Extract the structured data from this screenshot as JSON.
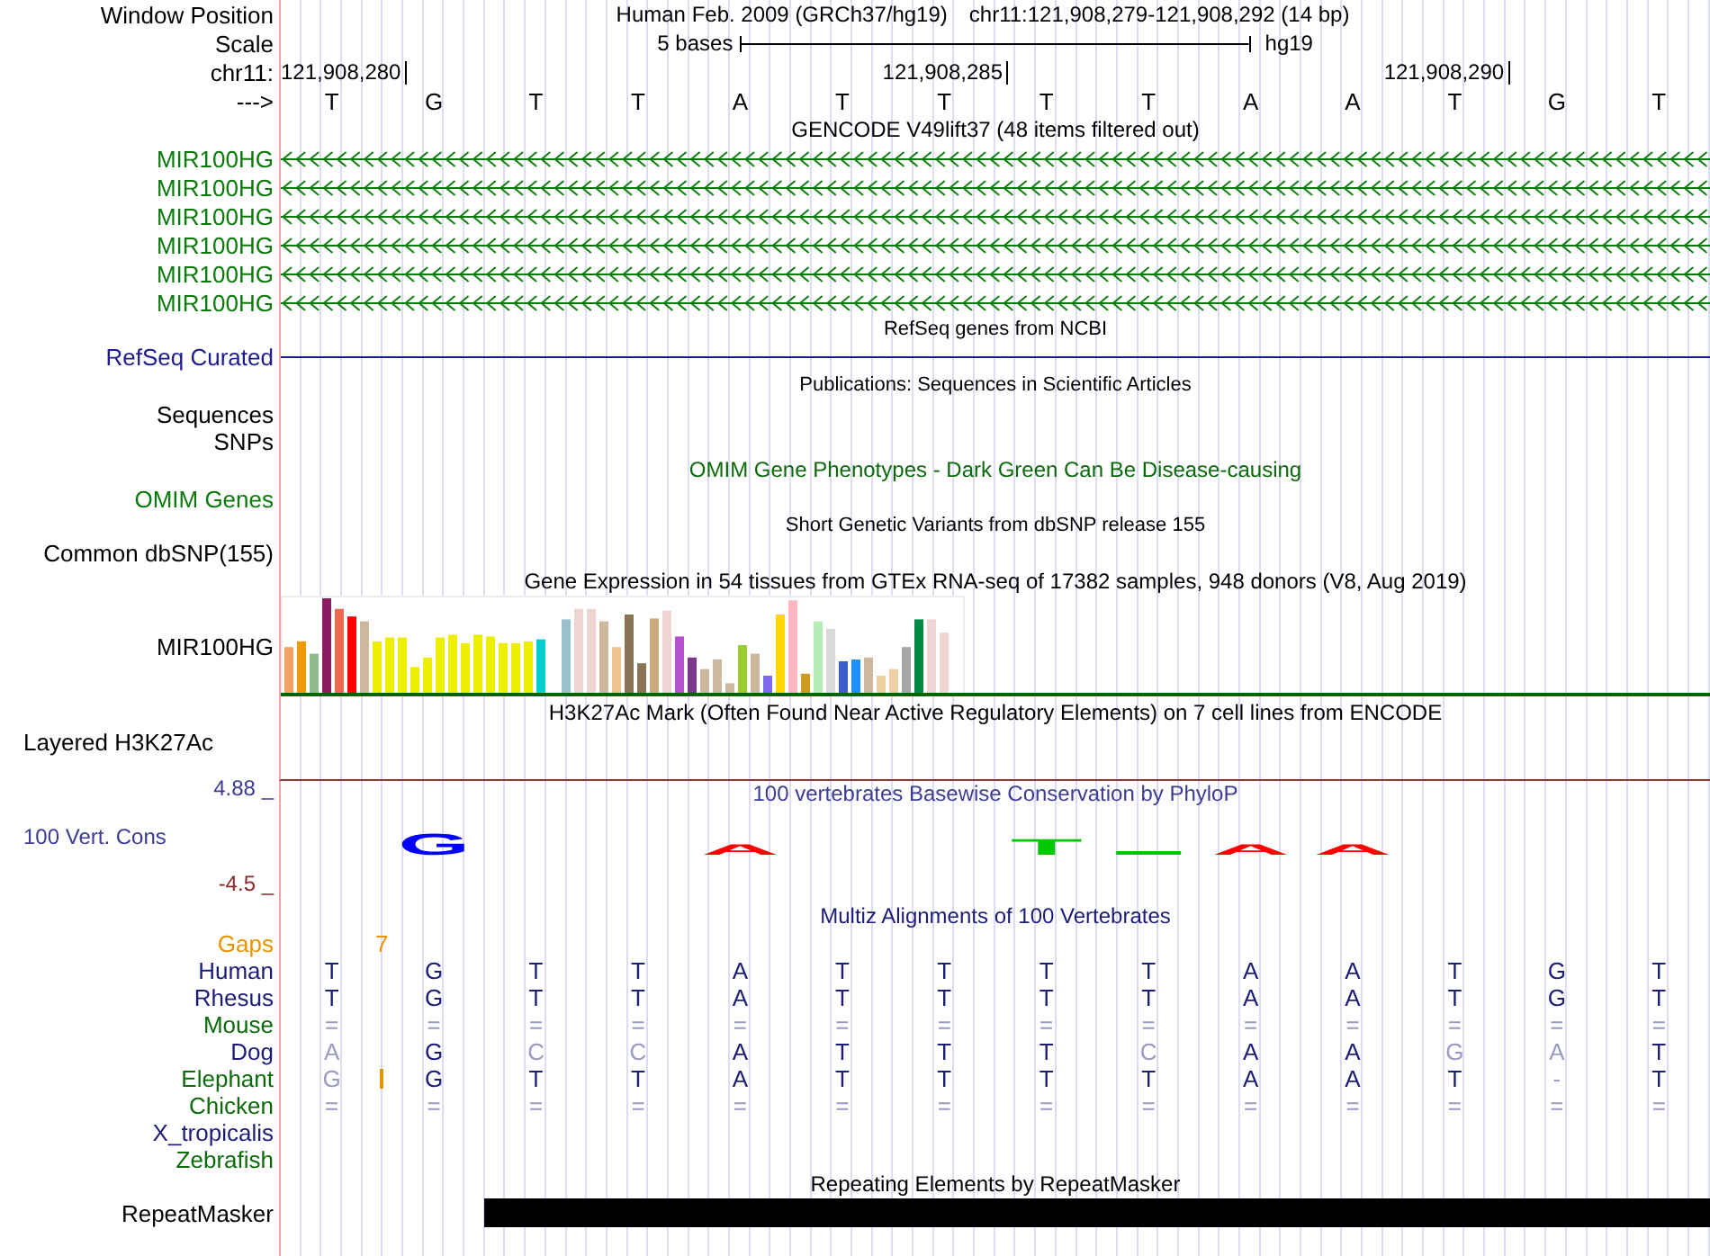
{
  "ruler": {
    "position_label": "Window Position",
    "assembly": "Human Feb. 2009 (GRCh37/hg19)",
    "position": "chr11:121,908,279-121,908,292 (14 bp)",
    "scale_label": "Scale",
    "scale_text": "5 bases",
    "scale_db": "hg19",
    "chrom_label": "chr11:",
    "ticks": [
      "121,908,280",
      "121,908,285",
      "121,908,290"
    ],
    "strand_label": "--->",
    "bases": [
      "T",
      "G",
      "T",
      "T",
      "A",
      "T",
      "T",
      "T",
      "T",
      "A",
      "A",
      "T",
      "G",
      "T"
    ]
  },
  "gencode": {
    "title": "GENCODE V49lift37 (48 items filtered out)",
    "items": [
      "MIR100HG",
      "MIR100HG",
      "MIR100HG",
      "MIR100HG",
      "MIR100HG",
      "MIR100HG"
    ]
  },
  "refseq": {
    "title": "RefSeq genes from NCBI",
    "label": "RefSeq Curated"
  },
  "publications": {
    "title": "Publications: Sequences in Scientific Articles",
    "label_lines": [
      "Sequences",
      "SNPs"
    ]
  },
  "omim": {
    "title": "OMIM Gene Phenotypes - Dark Green Can Be Disease-causing",
    "label": "OMIM Genes"
  },
  "dbsnp": {
    "title": "Short Genetic Variants from dbSNP release 155",
    "label": "Common dbSNP(155)"
  },
  "gtex": {
    "title": "Gene Expression in 54 tissues from GTEx RNA-seq of 17382 samples, 948 donors (V8, Aug 2019)",
    "label": "MIR100HG"
  },
  "h3k27ac": {
    "title": "H3K27Ac Mark (Often Found Near Active Regulatory Elements) on 7 cell lines from ENCODE",
    "label": "Layered H3K27Ac"
  },
  "conservation": {
    "title": "100 vertebrates Basewise Conservation by PhyloP",
    "label": "100 Vert. Cons",
    "axis_max": "4.88 _",
    "axis_min": "-4.5 _",
    "logo": [
      {
        "kind": "gap"
      },
      {
        "kind": "tall",
        "text": "G",
        "color": "#0000ff"
      },
      {
        "kind": "gap"
      },
      {
        "kind": "gap"
      },
      {
        "kind": "flat",
        "text": "A",
        "color": "#ff0000"
      },
      {
        "kind": "gap"
      },
      {
        "kind": "gap"
      },
      {
        "kind": "mid",
        "text": "T",
        "color": "#00c800"
      },
      {
        "kind": "bar",
        "color": "#00c800"
      },
      {
        "kind": "flat",
        "text": "A",
        "color": "#ff0000"
      },
      {
        "kind": "flat",
        "text": "A",
        "color": "#ff0000"
      },
      {
        "kind": "gap"
      },
      {
        "kind": "gap"
      },
      {
        "kind": "gap"
      }
    ]
  },
  "multiz": {
    "title": "Multiz Alignments of 100 Vertebrates",
    "gaps": {
      "label": "Gaps",
      "counts": [
        "7"
      ]
    },
    "species": [
      {
        "name": "Human",
        "color": "#1c1c78",
        "bases": [
          {
            "text": "T",
            "faded": false
          },
          {
            "text": "G",
            "faded": false
          },
          {
            "text": "T",
            "faded": false
          },
          {
            "text": "T",
            "faded": false
          },
          {
            "text": "A",
            "faded": false
          },
          {
            "text": "T",
            "faded": false
          },
          {
            "text": "T",
            "faded": false
          },
          {
            "text": "T",
            "faded": false
          },
          {
            "text": "T",
            "faded": false
          },
          {
            "text": "A",
            "faded": false
          },
          {
            "text": "A",
            "faded": false
          },
          {
            "text": "T",
            "faded": false
          },
          {
            "text": "G",
            "faded": false
          },
          {
            "text": "T",
            "faded": false
          }
        ]
      },
      {
        "name": "Rhesus",
        "color": "#1c1c78",
        "bases": [
          {
            "text": "T",
            "faded": false
          },
          {
            "text": "G",
            "faded": false
          },
          {
            "text": "T",
            "faded": false
          },
          {
            "text": "T",
            "faded": false
          },
          {
            "text": "A",
            "faded": false
          },
          {
            "text": "T",
            "faded": false
          },
          {
            "text": "T",
            "faded": false
          },
          {
            "text": "T",
            "faded": false
          },
          {
            "text": "T",
            "faded": false
          },
          {
            "text": "A",
            "faded": false
          },
          {
            "text": "A",
            "faded": false
          },
          {
            "text": "T",
            "faded": false
          },
          {
            "text": "G",
            "faded": false
          },
          {
            "text": "T",
            "faded": false
          }
        ]
      },
      {
        "name": "Mouse",
        "color": "#0b6b0b",
        "bases": [
          {
            "text": "=",
            "faded": true
          },
          {
            "text": "=",
            "faded": true
          },
          {
            "text": "=",
            "faded": true
          },
          {
            "text": "=",
            "faded": true
          },
          {
            "text": "=",
            "faded": true
          },
          {
            "text": "=",
            "faded": true
          },
          {
            "text": "=",
            "faded": true
          },
          {
            "text": "=",
            "faded": true
          },
          {
            "text": "=",
            "faded": true
          },
          {
            "text": "=",
            "faded": true
          },
          {
            "text": "=",
            "faded": true
          },
          {
            "text": "=",
            "faded": true
          },
          {
            "text": "=",
            "faded": true
          },
          {
            "text": "=",
            "faded": true
          }
        ]
      },
      {
        "name": "Dog",
        "color": "#1c1c78",
        "bases": [
          {
            "text": "A",
            "faded": true
          },
          {
            "text": "G",
            "faded": false
          },
          {
            "text": "C",
            "faded": true
          },
          {
            "text": "C",
            "faded": true
          },
          {
            "text": "A",
            "faded": false
          },
          {
            "text": "T",
            "faded": false
          },
          {
            "text": "T",
            "faded": false
          },
          {
            "text": "T",
            "faded": false
          },
          {
            "text": "C",
            "faded": true
          },
          {
            "text": "A",
            "faded": false
          },
          {
            "text": "A",
            "faded": false
          },
          {
            "text": "G",
            "faded": true
          },
          {
            "text": "A",
            "faded": true
          },
          {
            "text": "T",
            "faded": false
          }
        ]
      },
      {
        "name": "Elephant",
        "color": "#0b6b0b",
        "bases": [
          {
            "text": "G",
            "faded": true,
            "insertion_after": true
          },
          {
            "text": "G",
            "faded": false
          },
          {
            "text": "T",
            "faded": false
          },
          {
            "text": "T",
            "faded": false
          },
          {
            "text": "A",
            "faded": false
          },
          {
            "text": "T",
            "faded": false
          },
          {
            "text": "T",
            "faded": false
          },
          {
            "text": "T",
            "faded": false
          },
          {
            "text": "T",
            "faded": false
          },
          {
            "text": "A",
            "faded": false
          },
          {
            "text": "A",
            "faded": false
          },
          {
            "text": "T",
            "faded": false
          },
          {
            "text": "-",
            "faded": true
          },
          {
            "text": "T",
            "faded": false
          }
        ]
      },
      {
        "name": "Chicken",
        "color": "#0b6b0b",
        "bases": [
          {
            "text": "=",
            "faded": true
          },
          {
            "text": "=",
            "faded": true
          },
          {
            "text": "=",
            "faded": true
          },
          {
            "text": "=",
            "faded": true
          },
          {
            "text": "=",
            "faded": true
          },
          {
            "text": "=",
            "faded": true
          },
          {
            "text": "=",
            "faded": true
          },
          {
            "text": "=",
            "faded": true
          },
          {
            "text": "=",
            "faded": true
          },
          {
            "text": "=",
            "faded": true
          },
          {
            "text": "=",
            "faded": true
          },
          {
            "text": "=",
            "faded": true
          },
          {
            "text": "=",
            "faded": true
          },
          {
            "text": "=",
            "faded": true
          }
        ]
      },
      {
        "name": "X_tropicalis",
        "color": "#1c1c78"
      },
      {
        "name": "Zebrafish",
        "color": "#0b6b0b"
      }
    ]
  },
  "repeatmasker": {
    "title": "Repeating Elements by RepeatMasker",
    "label": "RepeatMasker"
  }
}
